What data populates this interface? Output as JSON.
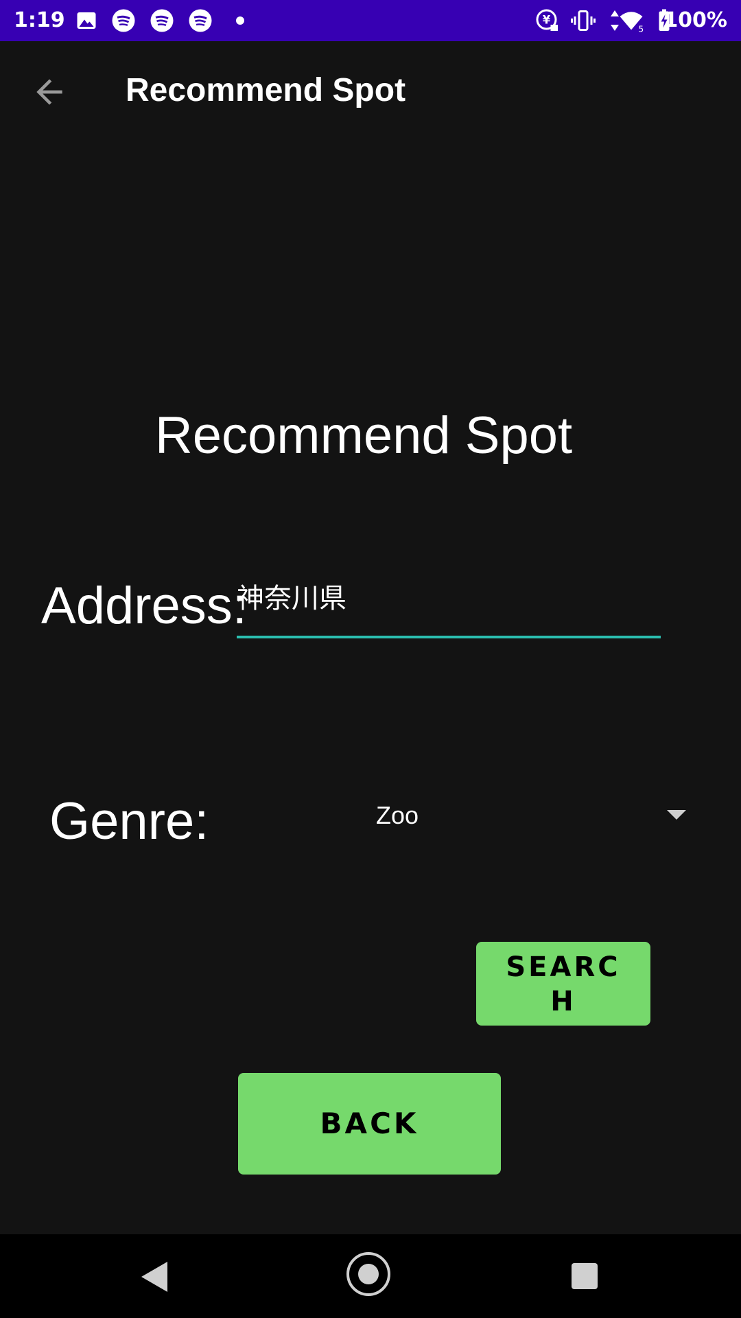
{
  "status_bar": {
    "time": "1:19",
    "battery": "100%",
    "icons": [
      "image-icon",
      "spotify-icon",
      "spotify-icon",
      "spotify-icon",
      "dot-icon",
      "data-saver-icon",
      "vibrate-icon",
      "data-arrows-icon",
      "wifi-icon",
      "battery-charging-icon"
    ],
    "background_color": "#3700b3"
  },
  "app_bar": {
    "title": "Recommend Spot",
    "back_icon": "arrow-back-icon"
  },
  "main": {
    "heading": "Recommend Spot",
    "address": {
      "label": "Address:",
      "value": "神奈川県",
      "underline_color": "#2bbfb0"
    },
    "genre": {
      "label": "Genre:",
      "selected": "Zoo",
      "dropdown_icon": "caret-down-icon"
    },
    "search_button": "SEARCH",
    "back_button": "BACK",
    "button_color": "#76d96c"
  },
  "nav_bar": {
    "icons": [
      "nav-back-icon",
      "nav-home-icon",
      "nav-recents-icon"
    ]
  }
}
